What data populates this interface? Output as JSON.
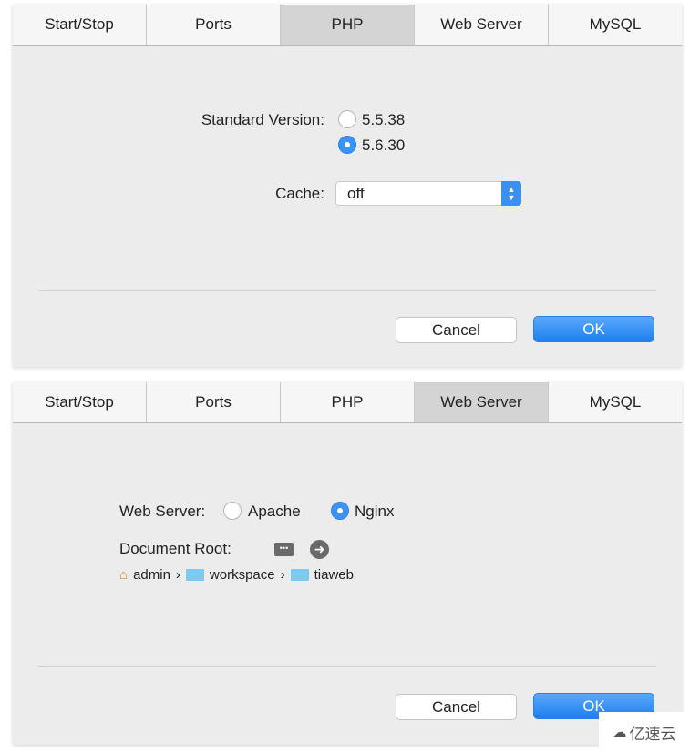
{
  "tabs": [
    "Start/Stop",
    "Ports",
    "PHP",
    "Web Server",
    "MySQL"
  ],
  "php_panel": {
    "active_tab": "PHP",
    "version_label": "Standard Version:",
    "versions": [
      "5.5.38",
      "5.6.30"
    ],
    "selected_version": "5.6.30",
    "cache_label": "Cache:",
    "cache_value": "off",
    "cancel": "Cancel",
    "ok": "OK"
  },
  "web_panel": {
    "active_tab": "Web Server",
    "server_label": "Web Server:",
    "servers": [
      "Apache",
      "Nginx"
    ],
    "selected_server": "Nginx",
    "docroot_label": "Document Root:",
    "path": [
      "admin",
      "workspace",
      "tiaweb"
    ],
    "path_sep": "›",
    "cancel": "Cancel",
    "ok": "OK"
  },
  "watermark": "亿速云",
  "colors": {
    "accent": "#3a93f5"
  }
}
